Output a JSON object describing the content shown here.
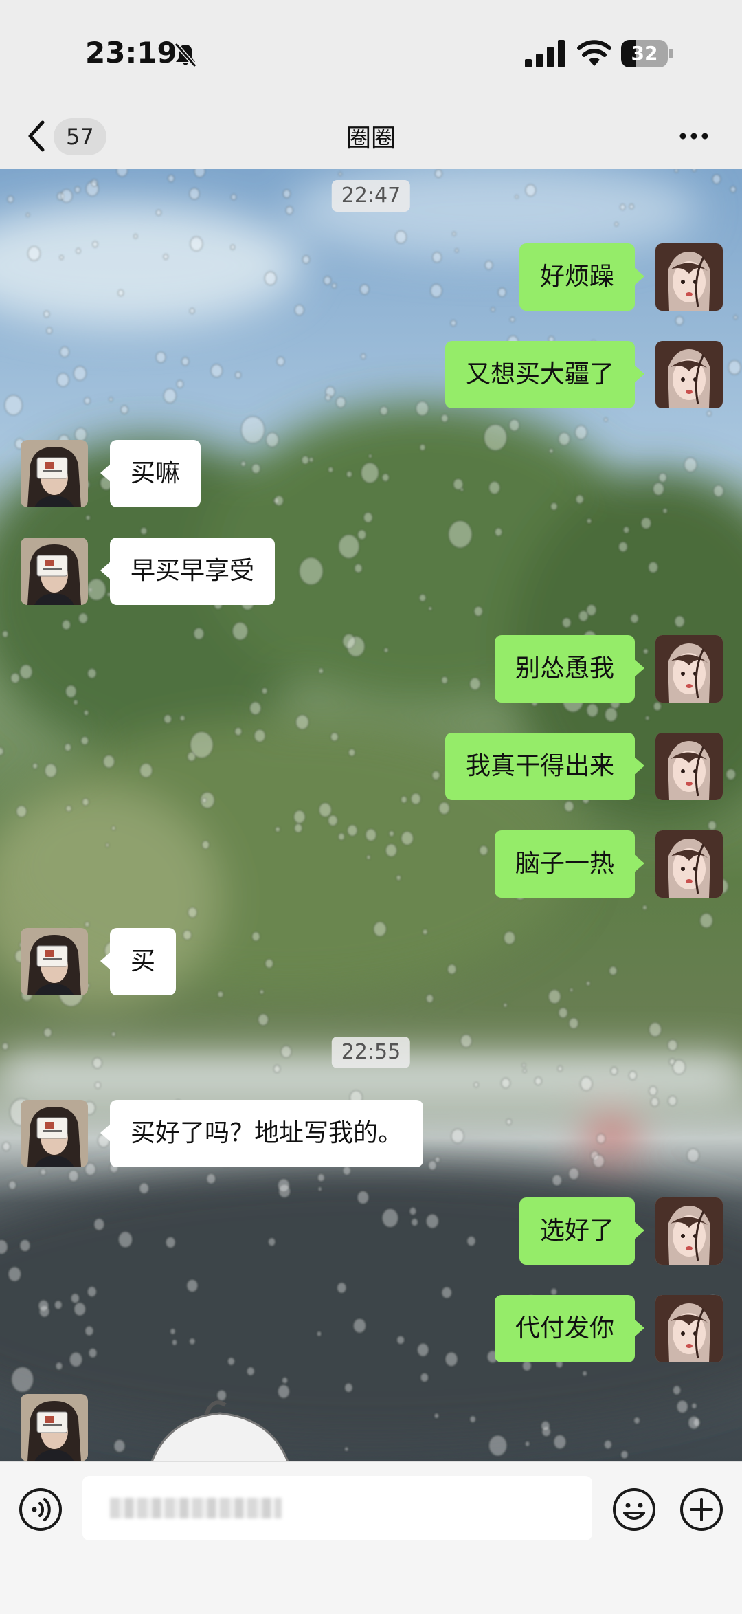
{
  "status_bar": {
    "time": "23:19",
    "battery": "32",
    "battery_level": 0.32
  },
  "nav": {
    "back_count": "57",
    "title": "圈圈"
  },
  "chat": {
    "timestamps": [
      "22:47",
      "22:55"
    ],
    "messages": [
      {
        "from": "me",
        "text": "好烦躁"
      },
      {
        "from": "me",
        "text": "又想买大疆了"
      },
      {
        "from": "them",
        "text": "买嘛"
      },
      {
        "from": "them",
        "text": "早买早享受"
      },
      {
        "from": "me",
        "text": "别怂恿我"
      },
      {
        "from": "me",
        "text": "我真干得出来"
      },
      {
        "from": "me",
        "text": "脑子一热"
      },
      {
        "from": "them",
        "text": "买"
      },
      {
        "from": "them",
        "text": "买好了吗？地址写我的。"
      },
      {
        "from": "me",
        "text": "选好了"
      },
      {
        "from": "me",
        "text": "代付发你"
      }
    ]
  },
  "icons": {
    "status": [
      "bell-muted-icon",
      "signal-icon",
      "wifi-icon",
      "battery-icon"
    ],
    "nav": [
      "back-chevron-icon",
      "more-icon"
    ],
    "input": [
      "voice-icon",
      "emoji-icon",
      "plus-icon"
    ]
  },
  "colors": {
    "my_bubble": "#95ec69",
    "their_bubble": "#ffffff",
    "chrome": "#ededed"
  }
}
